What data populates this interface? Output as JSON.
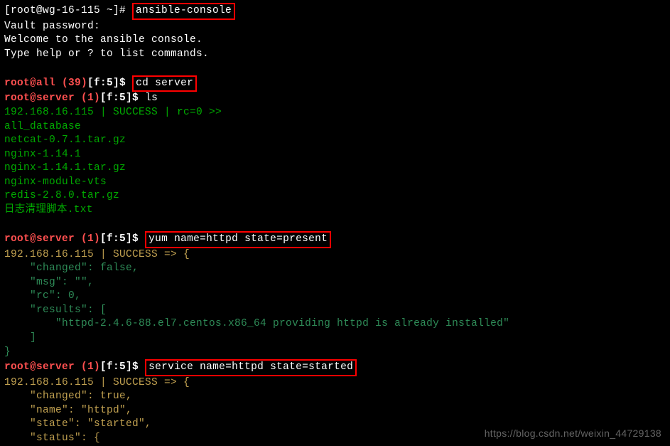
{
  "shell_prompt": "[root@wg-16-115 ~]# ",
  "cmd1": "ansible-console",
  "vault": "Vault password:",
  "welcome1": "Welcome to the ansible console.",
  "welcome2": "Type help or ? to list commands.",
  "prompt_all_user": "root@",
  "prompt_all_host": "all (39)",
  "prompt_all_forks": "[f:5]",
  "prompt_all_dollar": "$ ",
  "cmd2": "cd server",
  "prompt_srv_user": "root@",
  "prompt_srv_host": "server (1)",
  "prompt_srv_forks": "[f:5]",
  "prompt_srv_dollar": "$ ",
  "cmd_ls": "ls",
  "ls_header": "192.168.16.115 | SUCCESS | rc=0 >>",
  "ls_f1": "all_database",
  "ls_f2": "netcat-0.7.1.tar.gz",
  "ls_f3": "nginx-1.14.1",
  "ls_f4": "nginx-1.14.1.tar.gz",
  "ls_f5": "nginx-module-vts",
  "ls_f6": "redis-2.8.0.tar.gz",
  "ls_f7": "日志清理脚本.txt",
  "cmd_yum": "yum name=httpd state=present",
  "yum_header": "192.168.16.115 | SUCCESS => {",
  "yum_l1": "    \"changed\": false,",
  "yum_l2": "    \"msg\": \"\",",
  "yum_l3": "    \"rc\": 0,",
  "yum_l4": "    \"results\": [",
  "yum_l5": "        \"httpd-2.4.6-88.el7.centos.x86_64 providing httpd is already installed\"",
  "yum_l6": "    ]",
  "yum_l7": "}",
  "cmd_svc": "service name=httpd state=started",
  "svc_header": "192.168.16.115 | SUCCESS => {",
  "svc_l1": "    \"changed\": true,",
  "svc_l2": "    \"name\": \"httpd\",",
  "svc_l3": "    \"state\": \"started\",",
  "svc_l4": "    \"status\": {",
  "watermark": "https://blog.csdn.net/weixin_44729138"
}
